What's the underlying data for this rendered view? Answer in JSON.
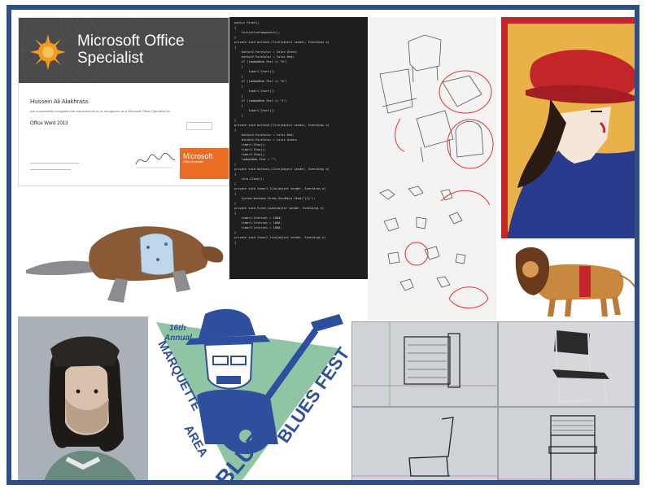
{
  "certificate": {
    "title_line1": "Microsoft Office",
    "title_line2": "Specialist",
    "recipient": "Hussein Ali Alakhrass",
    "statement": "has successfully completed the requirements to be recognized as a Microsoft Office Specialist for",
    "subject": "Office Word 2013",
    "badge_line1": "Microsoft",
    "badge_line2": "Office Specialist"
  },
  "code_panel": {
    "lines": [
      "public Form1()",
      "{",
      "    InitializeComponent();",
      "}",
      "private void button2_Click(object sender, EventArgs e)",
      "{",
      "    button2.ForeColor = Color.Green;",
      "    button3.ForeColor = Color.Red;",
      "    if (lambdaBob.Text == \"0\")",
      "    {",
      "        timer1.Start();",
      "    }",
      "    if (lambdaBob.Text == \"0\")",
      "    {",
      "        timer1.Start();",
      "    }",
      "    if (lambdaBob.Text == \"1\")",
      "    {",
      "        timer1.Start();",
      "    }",
      "}",
      "private void button3_Click(object sender, EventArgs e)",
      "{",
      "    button3.ForeColor = Color.Red;",
      "    button2.ForeColor = Color.Green;",
      "    timer1.Stop();",
      "    timer2.Stop();",
      "    timer3.Stop();",
      "    lambdaBob.Text = \"\";",
      "}",
      "private void button1_Click(object sender, EventArgs e)",
      "{",
      "    this.Close();",
      "}",
      "private void timer1_Tick(object sender, EventArgs e)",
      "{",
      "    System.Windows.Forms.SendKeys.Send(\"{1}\");",
      "}",
      "private void Form1_Load(object sender, EventArgs e)",
      "{",
      "    timer1.Interval = 1000;",
      "    timer2.Interval = 1000;",
      "    timer3.Interval = 1000;",
      "}",
      "private void timer2_Tick(object sender, EventArgs e)",
      "{"
    ]
  },
  "blues_fest": {
    "edition_number": "16th",
    "edition_word": "Annual",
    "left_text_1": "MARQUETTE",
    "left_text_2": "AREA",
    "right_text_1": "BLUES FEST",
    "bottom_text": "BLUES"
  },
  "colors": {
    "frame": "#2d4f86",
    "cert_orange": "#eb6d25",
    "poster_gold": "#e9b248",
    "poster_red": "#c2262b",
    "blues_blue": "#2d4f9e",
    "blues_green": "#8fc4a4"
  }
}
